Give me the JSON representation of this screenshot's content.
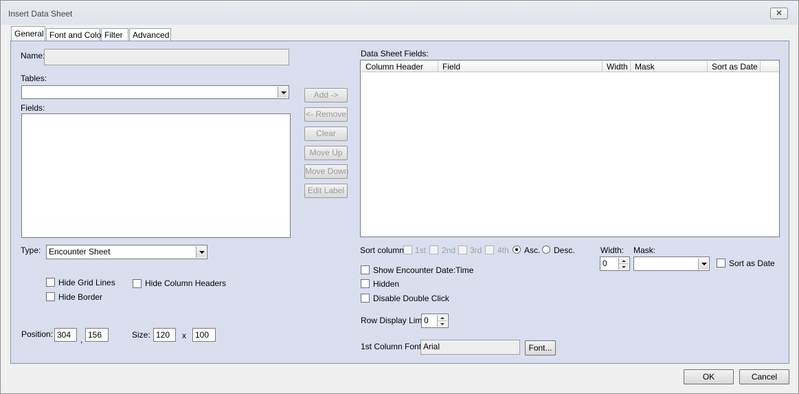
{
  "window": {
    "title": "Insert Data Sheet",
    "close_symbol": "✕"
  },
  "tabs": [
    {
      "label": "General"
    },
    {
      "label": "Font and Color"
    },
    {
      "label": "Filter"
    },
    {
      "label": "Advanced"
    }
  ],
  "left": {
    "name_label": "Name:",
    "name_value": "",
    "tables_label": "Tables:",
    "tables_value": "",
    "fields_label": "Fields:",
    "type_label": "Type:",
    "type_value": "Encounter Sheet",
    "hide_grid_lines": "Hide Grid Lines",
    "hide_column_headers": "Hide Column Headers",
    "hide_border": "Hide Border",
    "position_label": "Position:",
    "position_x": "304",
    "position_sep": ",",
    "position_y": "156",
    "size_label": "Size:",
    "size_w": "120",
    "size_sep": "x",
    "size_h": "100"
  },
  "middle_buttons": {
    "add": "Add ->",
    "remove": "<- Remove",
    "clear": "Clear",
    "move_up": "Move Up",
    "move_down": "Move Down",
    "edit_label": "Edit Label"
  },
  "right": {
    "fields_label": "Data Sheet Fields:",
    "columns": [
      "Column Header",
      "Field",
      "Width",
      "Mask",
      "Sort as Date"
    ],
    "sort_column_label": "Sort column:",
    "sort_1st": "1st",
    "sort_2nd": "2nd",
    "sort_3rd": "3rd",
    "sort_4th": "4th",
    "asc": "Asc.",
    "desc": "Desc.",
    "show_encounter_date": "Show Encounter Date:Time",
    "hidden": "Hidden",
    "disable_double_click": "Disable Double Click",
    "row_display_limit_label": "Row Display Limit:",
    "row_display_limit_value": "0",
    "first_column_font_label": "1st Column Font",
    "first_column_font_value": "Arial",
    "font_button": "Font...",
    "width_label": "Width:",
    "width_value": "0",
    "mask_label": "Mask:",
    "mask_value": "",
    "sort_as_date": "Sort as Date"
  },
  "footer": {
    "ok": "OK",
    "cancel": "Cancel"
  }
}
